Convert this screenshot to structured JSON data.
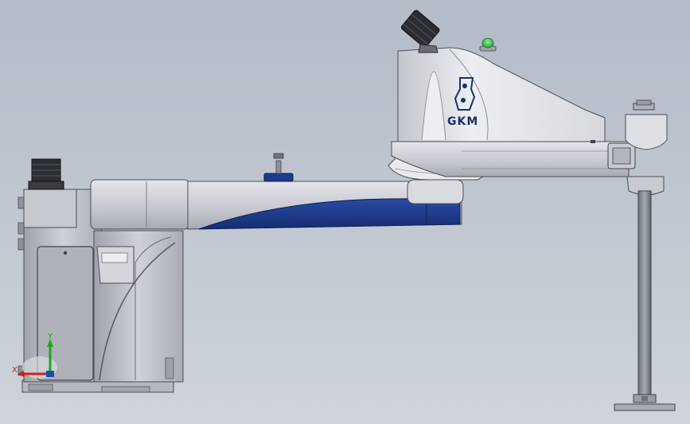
{
  "model": {
    "brand": "GKM"
  },
  "triad": {
    "y_label": "Y",
    "x_label": "X"
  },
  "colors": {
    "background_top": "#b3bbc7",
    "background_bottom": "#cfd4da",
    "body_gray": "#c9cbd3",
    "arm_blue": "#1c3a8c",
    "logo_navy": "#1d2f6b",
    "indicator_green": "#2fc44a",
    "axis_green": "#1fa51f",
    "axis_red": "#d02020"
  }
}
